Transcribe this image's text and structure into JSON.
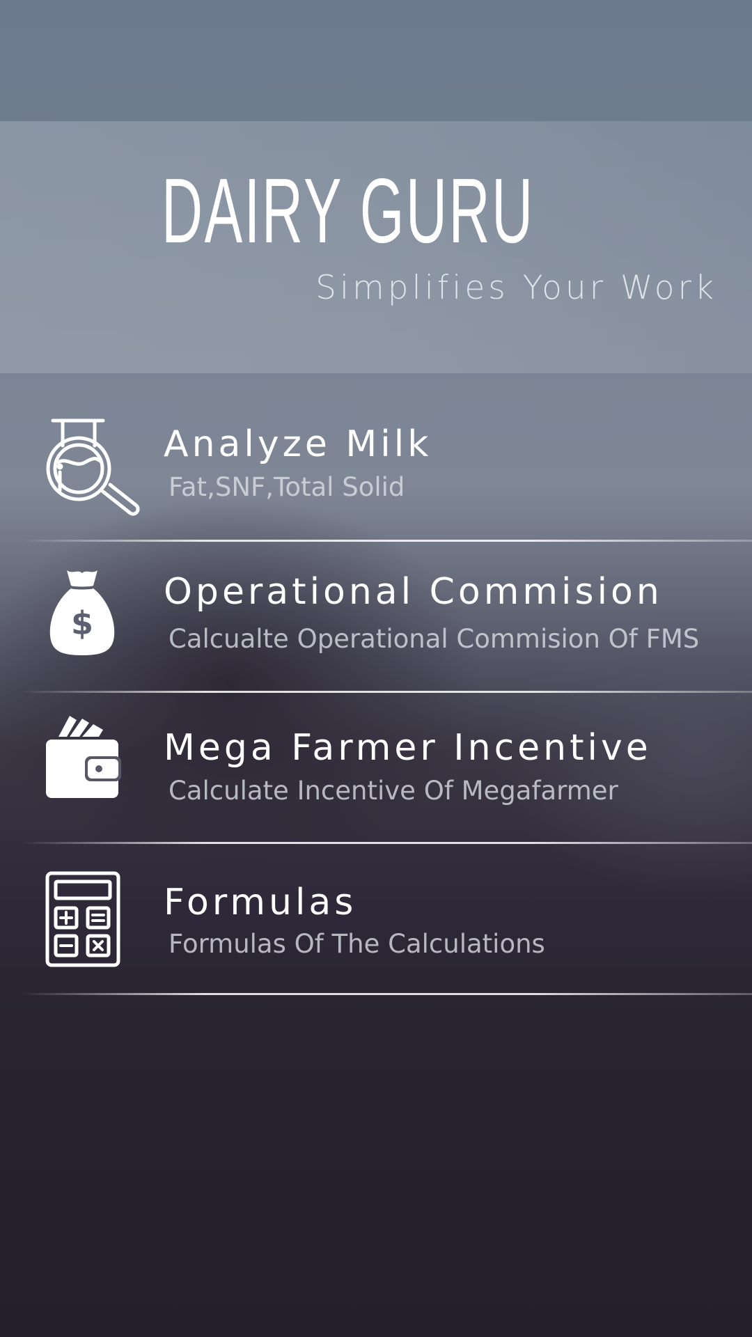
{
  "header": {
    "title": "DAIRY GURU",
    "tagline": "Simplifies Your Work"
  },
  "menu": {
    "items": [
      {
        "icon": "milk-analysis-magnifier-icon",
        "title": "Analyze Milk",
        "subtitle": "Fat,SNF,Total Solid"
      },
      {
        "icon": "money-bag-icon",
        "title": "Operational Commision",
        "subtitle": "Calcualte Operational Commision Of FMS"
      },
      {
        "icon": "wallet-icon",
        "title": "Mega Farmer Incentive",
        "subtitle": "Calculate Incentive Of Megafarmer"
      },
      {
        "icon": "calculator-icon",
        "title": "Formulas",
        "subtitle": "Formulas Of The Calculations"
      }
    ]
  },
  "colors": {
    "text_primary": "#ffffff",
    "text_secondary": "#dce0e6",
    "background_top": "#6b7a8d",
    "background_bottom": "#251f2b"
  }
}
